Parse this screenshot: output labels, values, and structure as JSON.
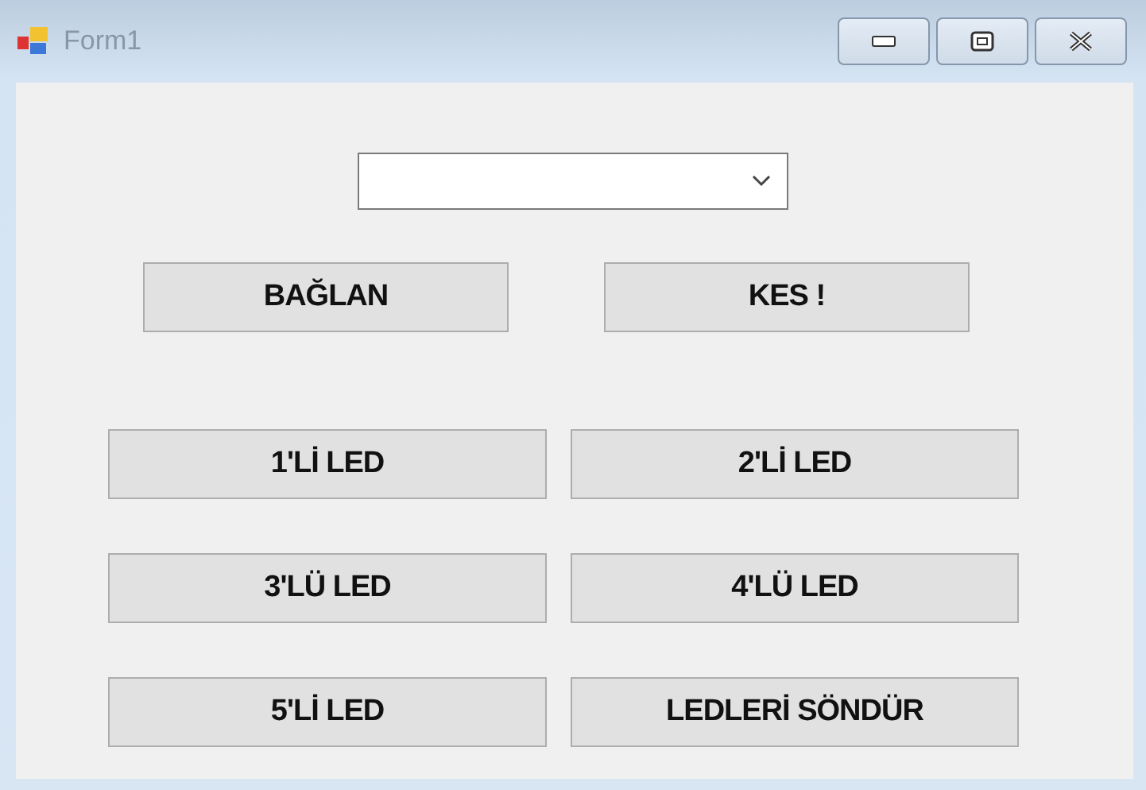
{
  "window": {
    "title": "Form1"
  },
  "connection_buttons": [
    "BAĞLAN",
    "KES !"
  ],
  "led_buttons": [
    [
      "1'Lİ LED",
      "2'Lİ LED"
    ],
    [
      "3'LÜ LED",
      "4'LÜ LED"
    ],
    [
      "5'Lİ LED",
      "LEDLERİ SÖNDÜR"
    ]
  ]
}
